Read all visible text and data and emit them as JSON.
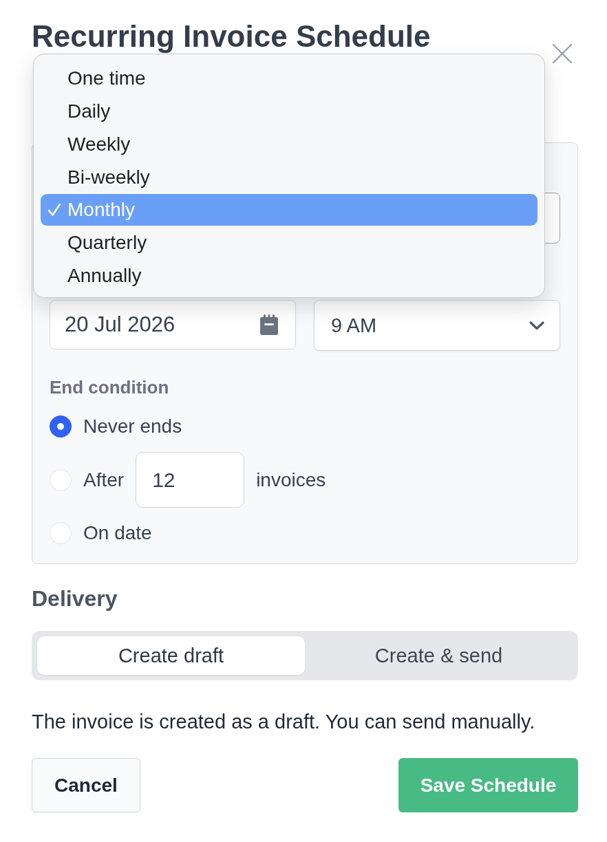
{
  "dialog": {
    "title": "Recurring Invoice Schedule"
  },
  "frequency_menu": {
    "options": [
      {
        "label": "One time",
        "selected": false
      },
      {
        "label": "Daily",
        "selected": false
      },
      {
        "label": "Weekly",
        "selected": false
      },
      {
        "label": "Bi-weekly",
        "selected": false
      },
      {
        "label": "Monthly",
        "selected": true
      },
      {
        "label": "Quarterly",
        "selected": false
      },
      {
        "label": "Annually",
        "selected": false
      }
    ]
  },
  "schedule": {
    "date_field": {
      "value": "20 Jul 2026"
    },
    "time_select": {
      "value": "9 AM"
    },
    "end_condition": {
      "label": "End condition",
      "options": [
        {
          "kind": "plain",
          "label": "Never ends",
          "selected": true
        },
        {
          "kind": "count",
          "label": "After",
          "value": "12",
          "suffix": "invoices",
          "selected": false
        },
        {
          "kind": "plain",
          "label": "On date",
          "selected": false
        }
      ]
    }
  },
  "delivery": {
    "heading": "Delivery",
    "options": [
      {
        "label": "Create draft",
        "selected": true
      },
      {
        "label": "Create & send",
        "selected": false
      }
    ],
    "note": "The invoice is created as a draft. You can send manually."
  },
  "buttons": [
    {
      "kind": "secondary",
      "label": "Cancel"
    },
    {
      "kind": "primary",
      "label": "Save Schedule"
    }
  ]
}
